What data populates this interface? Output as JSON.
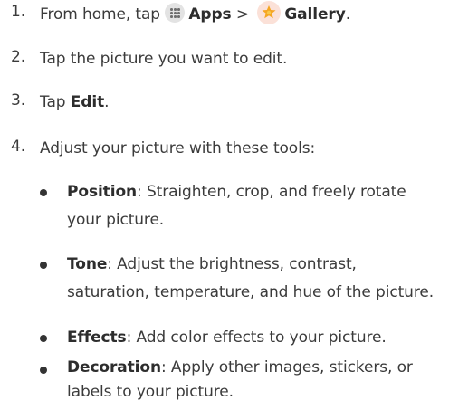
{
  "steps": [
    {
      "num": "1.",
      "pre": "From home, tap",
      "apps": "Apps",
      "sep": ">",
      "gallery": "Gallery",
      "end": "."
    },
    {
      "num": "2.",
      "text": "Tap the picture you want to edit."
    },
    {
      "num": "3.",
      "pre": "Tap",
      "bold": "Edit",
      "end": "."
    },
    {
      "num": "4.",
      "text": "Adjust your picture with these tools:"
    }
  ],
  "tools": [
    {
      "name": "Position",
      "desc": ": Straighten, crop, and freely rotate your picture."
    },
    {
      "name": "Tone",
      "desc": ": Adjust the brightness, contrast, saturation, temperature, and hue of the picture."
    },
    {
      "name": "Effects",
      "desc": ": Add color effects to your picture."
    },
    {
      "name": "Decoration",
      "desc": ": Apply other images, stickers, or labels to your picture."
    }
  ],
  "icons": {
    "apps": "apps-grid-icon",
    "gallery": "gallery-flower-icon",
    "gallery_color": "#f5a623"
  }
}
